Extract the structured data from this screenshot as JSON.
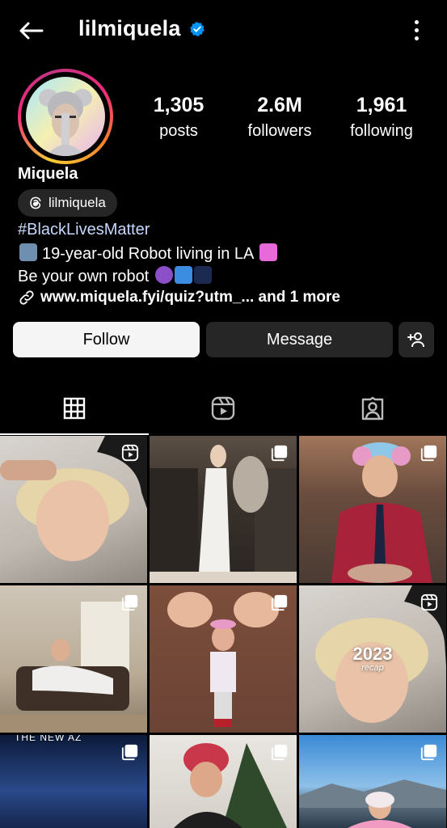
{
  "header": {
    "username": "lilmiquela",
    "back_icon": "arrow-left-icon",
    "verified_icon": "verified-badge-icon",
    "more_icon": "more-vertical-icon"
  },
  "profile": {
    "display_name": "Miquela",
    "threads_handle": "lilmiquela",
    "hashtag": "#BlackLivesMatter",
    "bio_line_1": "19-year-old Robot living in LA",
    "bio_line_2": "Be your own robot",
    "link_text": "www.miquela.fyi/quiz?utm_... and 1 more"
  },
  "stats": {
    "posts": {
      "value": "1,305",
      "label": "posts"
    },
    "followers": {
      "value": "2.6M",
      "label": "followers"
    },
    "following": {
      "value": "1,961",
      "label": "following"
    }
  },
  "actions": {
    "follow_label": "Follow",
    "message_label": "Message",
    "add_user_icon": "add-person-icon"
  },
  "tabs": [
    {
      "icon": "grid-icon",
      "active": true
    },
    {
      "icon": "reels-icon",
      "active": false
    },
    {
      "icon": "tagged-icon",
      "active": false
    }
  ],
  "posts": [
    {
      "type": "reel",
      "overlay_text": ""
    },
    {
      "type": "carousel",
      "overlay_text": ""
    },
    {
      "type": "carousel",
      "overlay_text": ""
    },
    {
      "type": "carousel",
      "overlay_text": ""
    },
    {
      "type": "carousel",
      "overlay_text": ""
    },
    {
      "type": "reel",
      "overlay_text": "2023",
      "overlay_sub": "recap"
    },
    {
      "type": "carousel",
      "overlay_text": "THE NEW AZ"
    },
    {
      "type": "carousel",
      "overlay_text": ""
    },
    {
      "type": "carousel",
      "overlay_text": ""
    }
  ],
  "colors": {
    "background": "#000000",
    "follow_button": "#f5f5f5",
    "secondary_button": "#262626",
    "verified": "#0095f6",
    "hashtag": "#c5d9ff"
  }
}
